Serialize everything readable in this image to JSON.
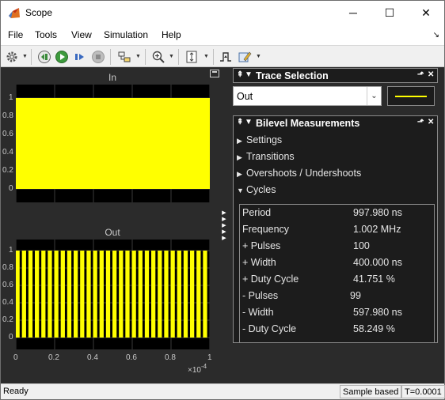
{
  "window": {
    "title": "Scope",
    "controls": {
      "minimize": "─",
      "maximize": "☐",
      "close": "✕"
    }
  },
  "menu": {
    "items": [
      "File",
      "Tools",
      "View",
      "Simulation",
      "Help"
    ],
    "dock_glyph": "↘"
  },
  "toolbar": {
    "buttons": [
      "configuration-properties",
      "step-back",
      "run",
      "step-forward",
      "stop",
      "highlight-simulink-block",
      "zoom",
      "scale-axes-limits",
      "triggers",
      "measurements"
    ]
  },
  "plots": {
    "top": {
      "title": "In",
      "y_ticks": [
        "1",
        "0.8",
        "0.6",
        "0.4",
        "0.2",
        "0"
      ],
      "line_color": "#ffff00"
    },
    "bottom": {
      "title": "Out",
      "y_ticks": [
        "1",
        "0.8",
        "0.6",
        "0.4",
        "0.2",
        "0"
      ],
      "x_ticks": [
        "0",
        "0.2",
        "0.4",
        "0.6",
        "0.8",
        "1"
      ],
      "x_exponent_base": "×10",
      "x_exponent_power": "-4",
      "line_color": "#ffff00"
    }
  },
  "trace_selection": {
    "title": "Trace Selection",
    "selected": "Out",
    "line_color": "#ffff00"
  },
  "bilevel": {
    "title": "Bilevel Measurements",
    "sections": [
      {
        "label": "Settings",
        "expanded": false
      },
      {
        "label": "Transitions",
        "expanded": false
      },
      {
        "label": "Overshoots / Undershoots",
        "expanded": false
      },
      {
        "label": "Cycles",
        "expanded": true
      }
    ],
    "cycles": [
      {
        "label": "Period",
        "value": "997.980 ns"
      },
      {
        "label": "Frequency",
        "value": "1.002 MHz"
      },
      {
        "label": "+ Pulses",
        "value": "100"
      },
      {
        "label": "+ Width",
        "value": "400.000 ns"
      },
      {
        "label": "+ Duty Cycle",
        "value": "41.751 %"
      },
      {
        "label": "- Pulses",
        "value": "99"
      },
      {
        "label": "- Width",
        "value": "597.980 ns"
      },
      {
        "label": "- Duty Cycle",
        "value": "58.249 %"
      }
    ]
  },
  "status": {
    "text": "Ready",
    "mode": "Sample based",
    "time": "T=0.0001"
  }
}
